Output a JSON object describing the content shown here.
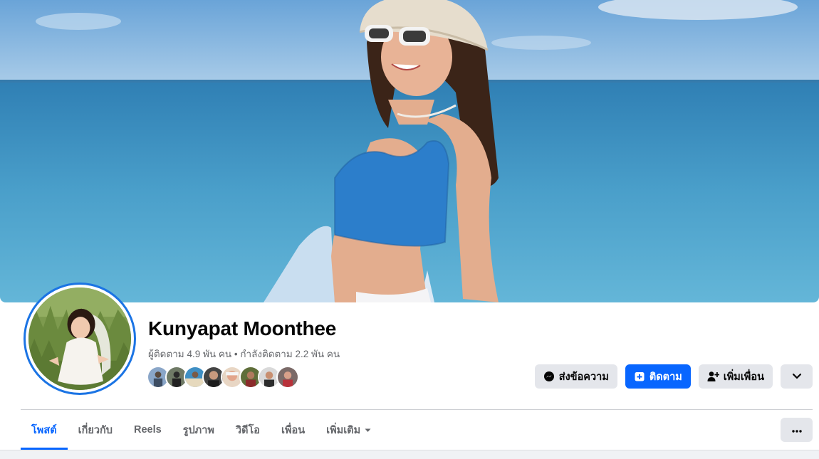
{
  "profile": {
    "name": "Kunyapat Moonthee",
    "stats": "ผู้ติดตาม 4.9 พัน คน • กำลังติดตาม 2.2 พัน คน",
    "friend_avatars": [
      "friend-1",
      "friend-2",
      "friend-3",
      "friend-4",
      "friend-5",
      "friend-6",
      "friend-7",
      "friend-8"
    ]
  },
  "actions": {
    "message": "ส่งข้อความ",
    "follow": "ติดตาม",
    "add_friend": "เพิ่มเพื่อน"
  },
  "tabs": [
    {
      "label": "โพสต์",
      "active": true
    },
    {
      "label": "เกี่ยวกับ"
    },
    {
      "label": "Reels"
    },
    {
      "label": "รูปภาพ"
    },
    {
      "label": "วิดีโอ"
    },
    {
      "label": "เพื่อน"
    },
    {
      "label": "เพิ่มเติม"
    }
  ],
  "colors": {
    "accent": "#0866ff",
    "ring": "#1b74e4",
    "button_gray": "#e4e6eb",
    "muted_text": "#65676b"
  },
  "icons": {
    "message": "messenger-icon",
    "follow": "follow-icon",
    "add_friend": "add-friend-icon",
    "dropdown": "chevron-down-icon",
    "more": "more-options-icon",
    "tab_more": "caret-down-icon"
  }
}
